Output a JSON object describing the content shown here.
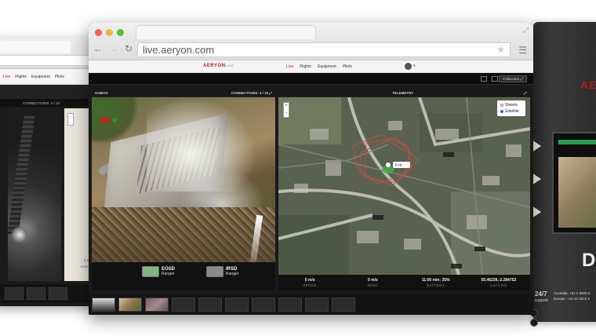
{
  "browser": {
    "url": "live.aeryon.com",
    "traffic_colors": [
      "#fc5b57",
      "#e5bf2f",
      "#57c038"
    ],
    "icons": {
      "back": "back-arrow-icon",
      "forward": "forward-arrow-icon",
      "reload": "reload-icon",
      "bookmark": "star-icon",
      "menu": "hamburger-menu-icon",
      "resize": "resize-icon"
    }
  },
  "site": {
    "brand": "AERYON",
    "brand_suffix": "LIVE",
    "nav": [
      "Live",
      "Flights",
      "Equipment",
      "Pilots"
    ],
    "active_nav": "Live",
    "user_caret": "▾",
    "fullscreen_label": "Fullscreen"
  },
  "back_window": {
    "nav": [
      "Live",
      "Flights",
      "Equipment",
      "Pilots"
    ],
    "connections": "CONNECTIONS: 4 / 10",
    "unit": "1 m/s",
    "speed_label": "SPEED"
  },
  "gobox": {
    "title": "GOBOX",
    "connections": "CONNECTIONS: 4 / 10",
    "sensors": [
      {
        "name": "EOSD",
        "sub": "Ranger",
        "color": "#7fb77e"
      },
      {
        "name": "IRSD",
        "sub": "Ranger",
        "color": "#8a8a8a"
      }
    ]
  },
  "telemetry": {
    "title": "TELEMETRY",
    "map_types": [
      "Streets",
      "Satellite"
    ],
    "selected_map": "Satellite",
    "zoom": {
      "in": "+",
      "out": "−"
    },
    "readouts": [
      {
        "value": "0 m/s",
        "label": "SPEED"
      },
      {
        "value": "0 m/s",
        "label": "WIND"
      },
      {
        "value": "11:00 min: 35%",
        "label": "BATTERY"
      },
      {
        "value": "55.46239,-2.284752",
        "label": "LAT/LNG"
      }
    ],
    "marker_label": "0 m"
  },
  "hardware": {
    "logo": "AER",
    "letter": "D",
    "support": "24/7",
    "support_sub": "support",
    "contacts": [
      "Australia: +61 2 8005 6",
      "Europe: +44 20 3519 2"
    ]
  }
}
